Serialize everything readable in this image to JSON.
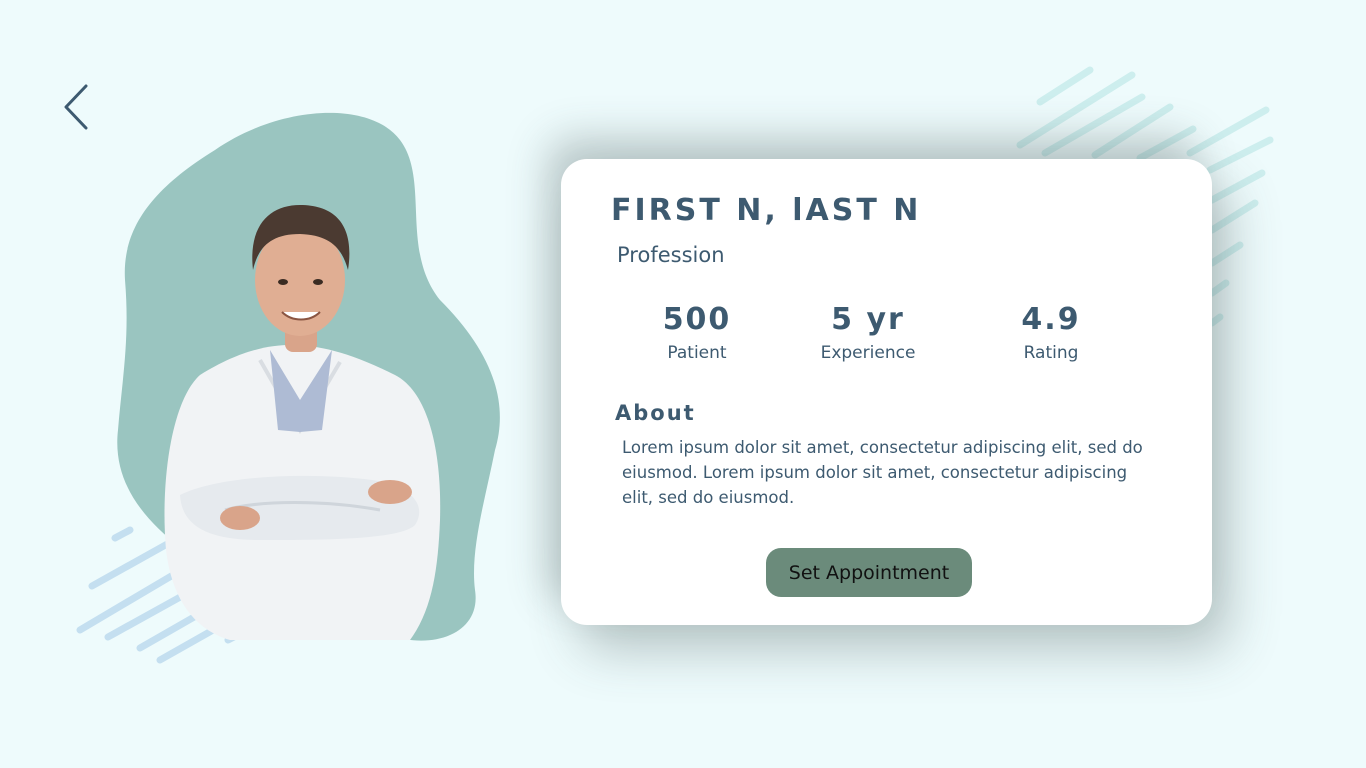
{
  "navigation": {
    "back_icon": "chevron-left-icon"
  },
  "doctor": {
    "name": "FIRST N, lAST N",
    "profession": "Profession"
  },
  "stats": [
    {
      "value": "500",
      "label": "Patient"
    },
    {
      "value": "5 yr",
      "label": "Experience"
    },
    {
      "value": "4.9",
      "label": "Rating"
    }
  ],
  "about": {
    "heading": "About",
    "text": "Lorem ipsum dolor sit amet, consectetur adipiscing elit, sed do eiusmod. Lorem ipsum dolor sit amet, consectetur adipiscing elit, sed do eiusmod."
  },
  "actions": {
    "appointment_label": "Set Appointment"
  },
  "colors": {
    "background": "#eefbfc",
    "blob": "#9ac5c0",
    "text": "#3d5a70",
    "button": "#6b8b7b",
    "deco_teal": "#cdeeee",
    "deco_blue": "#c4dff0"
  }
}
